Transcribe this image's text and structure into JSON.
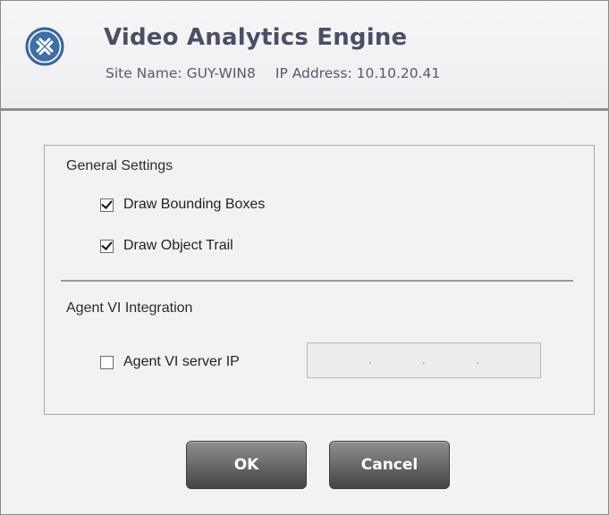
{
  "header": {
    "title": "Video Analytics Engine",
    "site_label": "Site Name: GUY-WIN8",
    "ip_label": "IP Address: 10.10.20.41",
    "logo_icon": "analytics-logo-icon"
  },
  "general": {
    "title": "General Settings",
    "draw_bounding_boxes": {
      "label": "Draw Bounding Boxes",
      "checked": true
    },
    "draw_object_trail": {
      "label": "Draw Object Trail",
      "checked": true
    }
  },
  "agent": {
    "title": "Agent VI Integration",
    "server_ip": {
      "label": "Agent VI server IP",
      "checked": false,
      "dots": [
        ".",
        ".",
        "."
      ]
    }
  },
  "buttons": {
    "ok": "OK",
    "cancel": "Cancel"
  },
  "colors": {
    "title_text": "#4a4f64",
    "logo_blue": "#3e6ea5",
    "button_dark": "#444444"
  }
}
